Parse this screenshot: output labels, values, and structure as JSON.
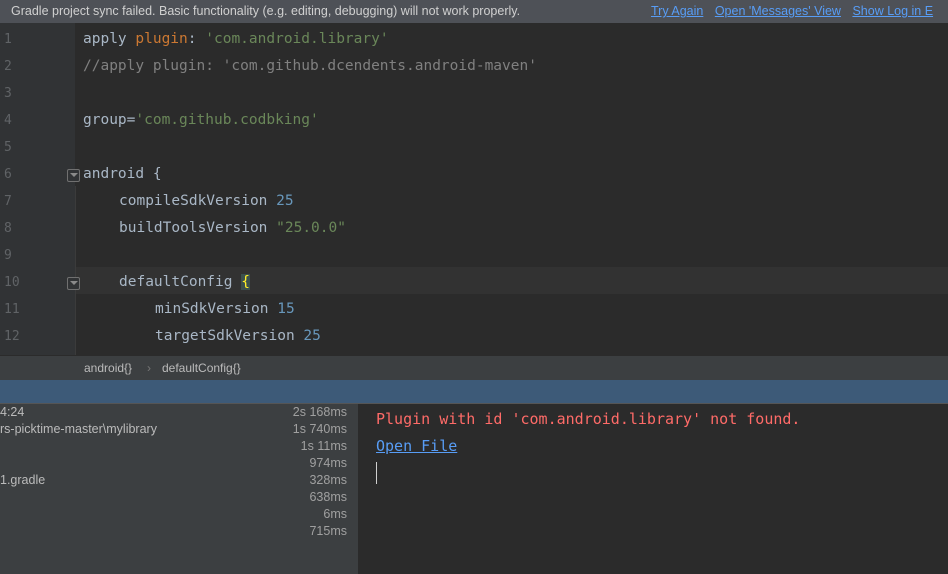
{
  "banner": {
    "message": "Gradle project sync failed. Basic functionality (e.g. editing, debugging) will not work properly.",
    "links": [
      "Try Again",
      "Open 'Messages' View",
      "Show Log in E"
    ]
  },
  "editor": {
    "line_numbers": [
      "1",
      "2",
      "3",
      "4",
      "5",
      "6",
      "7",
      "8",
      "9",
      "10",
      "11",
      "12"
    ],
    "lines": {
      "l1_a": "apply ",
      "l1_b": "plugin",
      "l1_c": ": ",
      "l1_d": "'com.android.library'",
      "l2": "//apply plugin: 'com.github.dcendents.android-maven'",
      "l4_a": "group",
      "l4_b": "=",
      "l4_c": "'com.github.codbking'",
      "l6": "android {",
      "l7_a": "compileSdkVersion ",
      "l7_b": "25",
      "l8_a": "buildToolsVersion ",
      "l8_b": "\"25.0.0\"",
      "l10_a": "defaultConfig ",
      "l10_b": "{",
      "l11_a": "minSdkVersion ",
      "l11_b": "15",
      "l12_a": "targetSdkVersion ",
      "l12_b": "25"
    }
  },
  "breadcrumb": {
    "items": [
      "android{}",
      "›",
      "defaultConfig{}"
    ]
  },
  "build_tree": {
    "rows": [
      {
        "label": "4:24",
        "time": "2s 168ms"
      },
      {
        "label": "rs-picktime-master\\mylibrary",
        "time": "1s 740ms"
      },
      {
        "label": "",
        "time": "1s 11ms"
      },
      {
        "label": "",
        "time": "974ms"
      },
      {
        "label": "1.gradle",
        "time": "328ms"
      },
      {
        "label": "",
        "time": "638ms"
      },
      {
        "label": "",
        "time": "6ms"
      },
      {
        "label": "",
        "time": "715ms"
      }
    ]
  },
  "console": {
    "error": "Plugin with id 'com.android.library' not found.",
    "open_file": "Open File"
  }
}
